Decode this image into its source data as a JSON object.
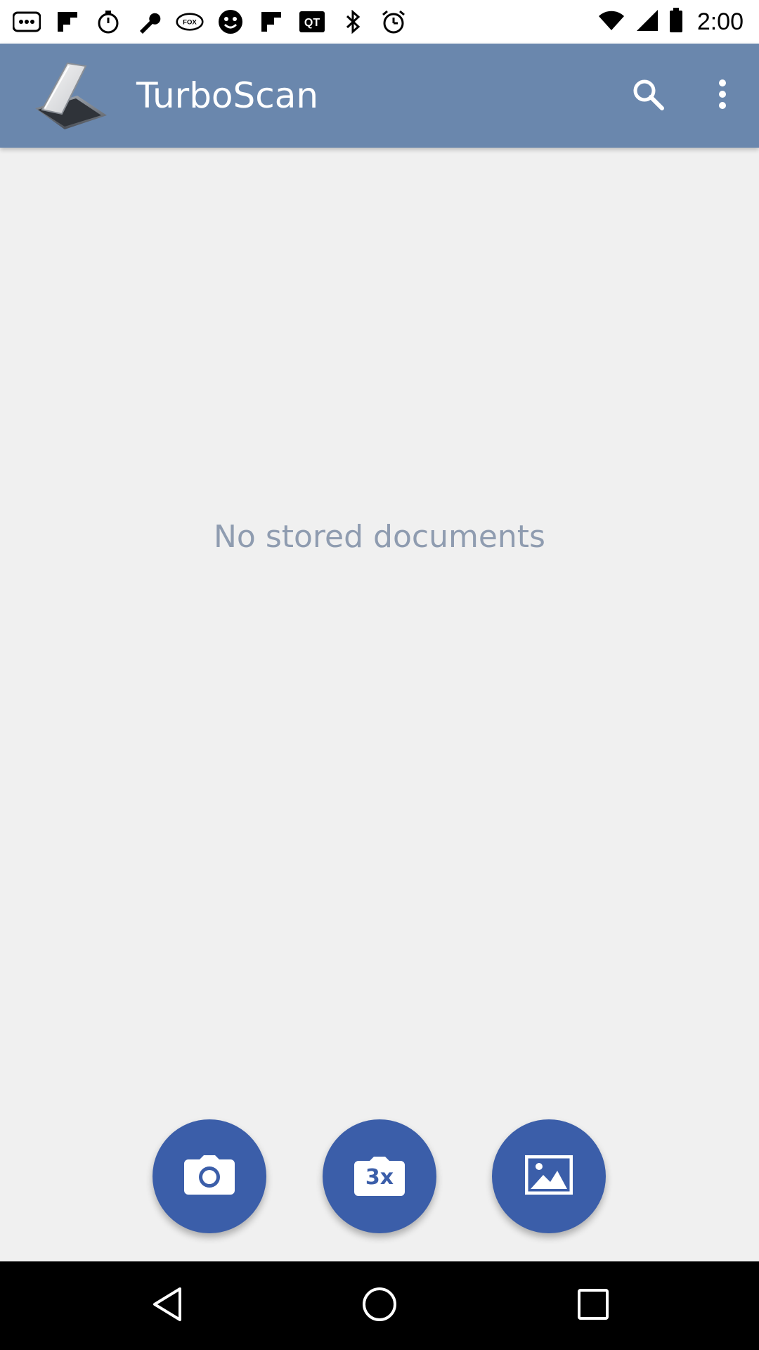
{
  "status_bar": {
    "time": "2:00",
    "left_icons": [
      "messaging-dots-icon",
      "flipboard-icon",
      "timer-icon",
      "wrench-icon",
      "fox-sports-icon",
      "smiley-icon",
      "flipboard-icon",
      "qt-icon",
      "bluetooth-icon",
      "alarm-icon"
    ],
    "right_icons": [
      "wifi-icon",
      "signal-icon",
      "battery-icon"
    ]
  },
  "toolbar": {
    "title": "TurboScan",
    "background_color": "#6a87ad",
    "actions": [
      "search-icon",
      "more-vert-icon"
    ]
  },
  "content": {
    "empty_message": "No stored documents"
  },
  "fabs": [
    {
      "name": "camera-icon",
      "label": ""
    },
    {
      "name": "multi-scan-icon",
      "label": "3x"
    },
    {
      "name": "gallery-icon",
      "label": ""
    }
  ],
  "fab_color": "#3b5ea9",
  "nav_bar": {
    "buttons": [
      "back-icon",
      "home-icon",
      "recents-icon"
    ]
  }
}
